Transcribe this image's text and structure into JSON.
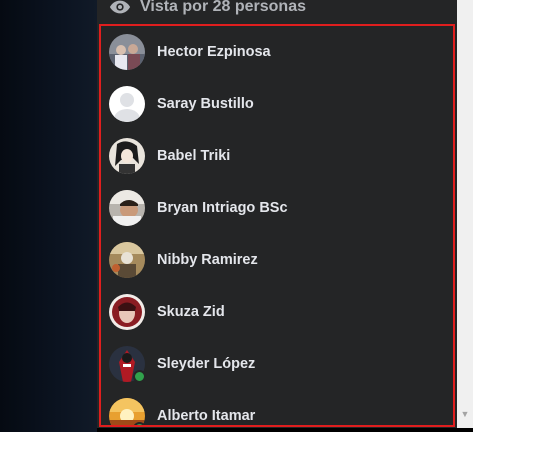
{
  "header": {
    "icon": "eye-icon",
    "title": "Vista por 28 personas"
  },
  "viewers": [
    {
      "name": "Hector Ezpinosa",
      "online": false,
      "avatar": "group-photo"
    },
    {
      "name": "Saray Bustillo",
      "online": false,
      "avatar": "default-silhouette"
    },
    {
      "name": "Babel Triki",
      "online": false,
      "avatar": "anime-drawing"
    },
    {
      "name": "Bryan Intriago BSc",
      "online": false,
      "avatar": "selfie"
    },
    {
      "name": "Nibby Ramirez",
      "online": false,
      "avatar": "photo"
    },
    {
      "name": "Skuza Zid",
      "online": false,
      "avatar": "photo-red"
    },
    {
      "name": "Sleyder López",
      "online": true,
      "avatar": "red-figure"
    },
    {
      "name": "Alberto Itamar",
      "online": true,
      "avatar": "sunset"
    }
  ],
  "colors": {
    "panel_bg": "#242526",
    "text": "#e4e6eb",
    "header_text": "#b0b3b8",
    "highlight_border": "#e01e1e",
    "online": "#31a24c"
  }
}
